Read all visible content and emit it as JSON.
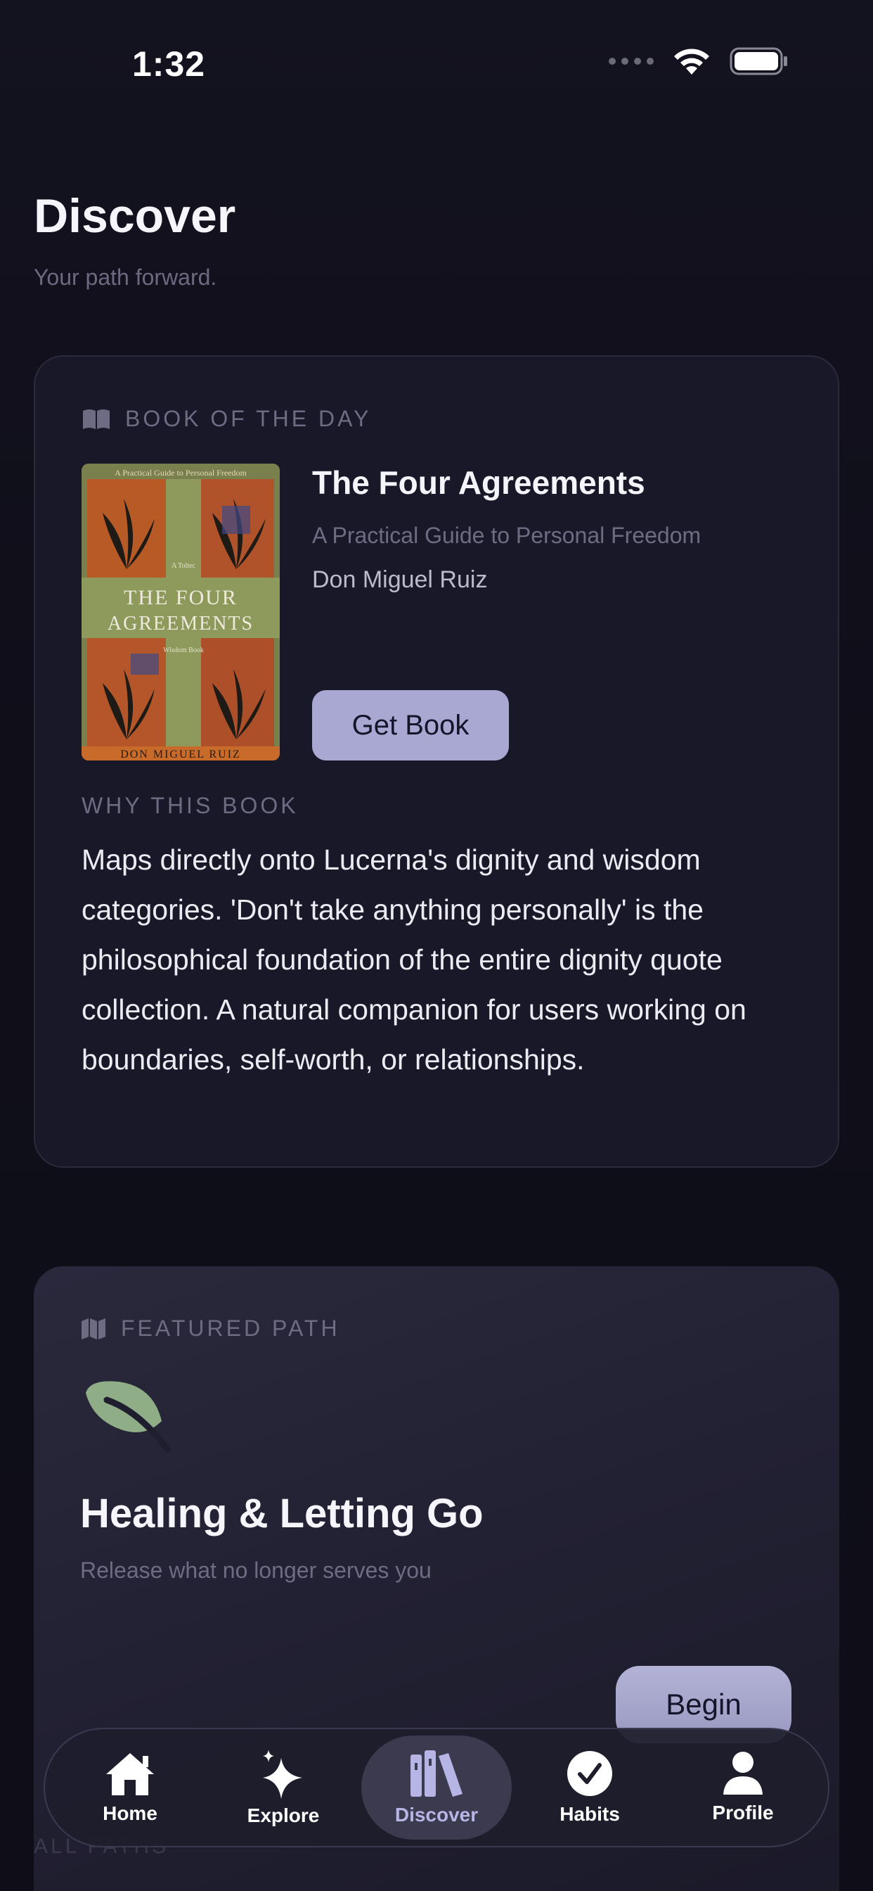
{
  "status_bar": {
    "time": "1:32"
  },
  "header": {
    "title": "Discover",
    "subtitle": "Your path forward."
  },
  "book_of_the_day": {
    "section_label": "BOOK OF THE DAY",
    "section_icon": "book-open-icon",
    "title": "The Four Agreements",
    "subtitle": "A Practical Guide to Personal Freedom",
    "author": "Don Miguel Ruiz",
    "cover": {
      "top_text": "A Practical Guide to Personal Freedom",
      "title_line1": "THE FOUR",
      "title_line2": "AGREEMENTS",
      "small_left": "A Toltec",
      "small_right": "Wisdom Book",
      "author_text": "DON MIGUEL RUIZ"
    },
    "cta_label": "Get Book",
    "why_label": "WHY THIS BOOK",
    "why_body": "Maps directly onto Lucerna's dignity and wisdom categories. 'Don't take anything personally' is the philosophical foundation of the entire dignity quote collection. A natural companion for users working on boundaries, self-worth, or relationships."
  },
  "featured_path": {
    "section_label": "FEATURED PATH",
    "section_icon": "map-icon",
    "icon": "leaf-icon",
    "title": "Healing & Letting Go",
    "subtitle": "Release what no longer serves you",
    "cta_label": "Begin"
  },
  "all_paths_label": "ALL PATHS",
  "tab_bar": {
    "items": [
      {
        "label": "Home",
        "icon": "home-icon",
        "active": false
      },
      {
        "label": "Explore",
        "icon": "sparkles-icon",
        "active": false
      },
      {
        "label": "Discover",
        "icon": "books-icon",
        "active": true
      },
      {
        "label": "Habits",
        "icon": "checkmark-circle-icon",
        "active": false
      },
      {
        "label": "Profile",
        "icon": "person-icon",
        "active": false
      }
    ]
  },
  "colors": {
    "background": "#0f0e1a",
    "card": "#191828",
    "accent": "#a9a8d2",
    "leaf": "#8fad86",
    "muted_text": "#6e6c82"
  }
}
